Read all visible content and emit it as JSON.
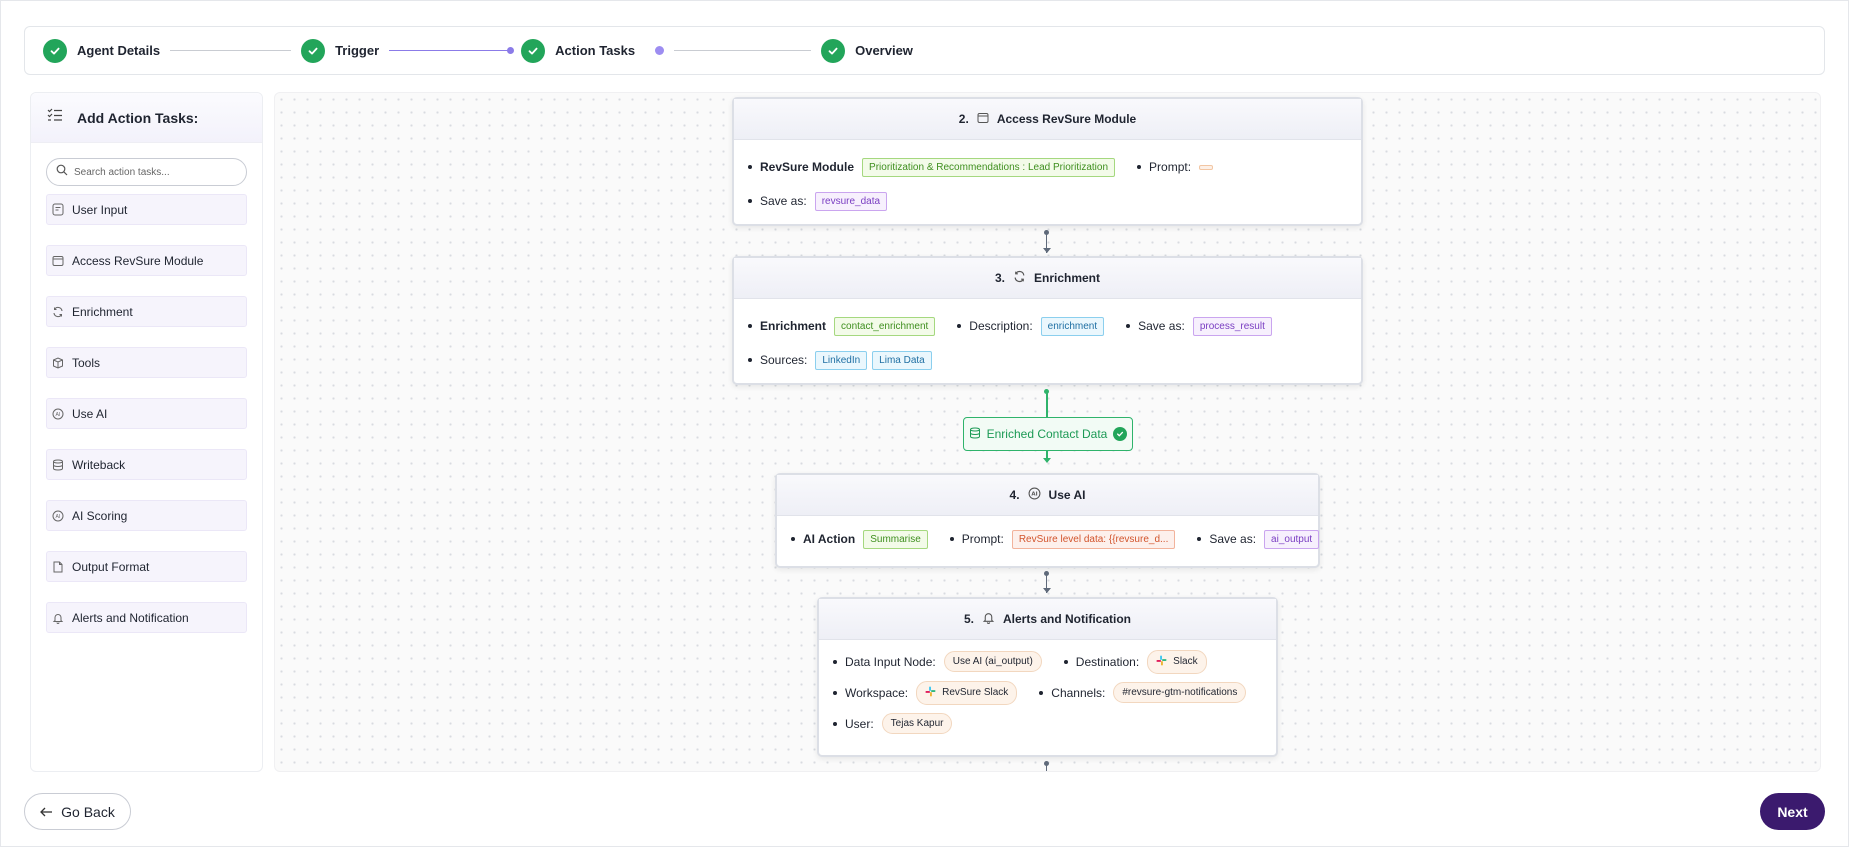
{
  "stepper": {
    "steps": [
      {
        "label": "Agent Details"
      },
      {
        "label": "Trigger"
      },
      {
        "label": "Action Tasks"
      },
      {
        "label": "Overview"
      }
    ]
  },
  "sidebar": {
    "title": "Add Action Tasks:",
    "search_placeholder": "Search action tasks...",
    "items": [
      {
        "label": "User Input",
        "icon": "user-input-icon"
      },
      {
        "label": "Access RevSure Module",
        "icon": "module-icon"
      },
      {
        "label": "Enrichment",
        "icon": "refresh-icon"
      },
      {
        "label": "Tools",
        "icon": "tools-icon"
      },
      {
        "label": "Use AI",
        "icon": "ai-icon"
      },
      {
        "label": "Writeback",
        "icon": "database-icon"
      },
      {
        "label": "AI Scoring",
        "icon": "ai-scoring-icon"
      },
      {
        "label": "Output Format",
        "icon": "document-icon"
      },
      {
        "label": "Alerts and Notification",
        "icon": "bell-icon"
      }
    ]
  },
  "nodes": {
    "n2": {
      "number": "2.",
      "title": "Access RevSure Module",
      "module_label": "RevSure Module",
      "module_value": "Prioritization & Recommendations : Lead Prioritization",
      "prompt_label": "Prompt:",
      "save_label": "Save as:",
      "save_value": "revsure_data"
    },
    "n3": {
      "number": "3.",
      "title": "Enrichment",
      "enrichment_label": "Enrichment",
      "enrichment_value": "contact_enrichment",
      "description_label": "Description:",
      "description_value": "enrichment",
      "save_label": "Save as:",
      "save_value": "process_result",
      "sources_label": "Sources:",
      "sources": [
        "LinkedIn",
        "Lima Data"
      ]
    },
    "data_output": {
      "label": "Enriched Contact Data"
    },
    "n4": {
      "number": "4.",
      "title": "Use AI",
      "action_label": "AI Action",
      "action_value": "Summarise",
      "prompt_label": "Prompt:",
      "prompt_value": "RevSure level data: {{revsure_d...",
      "save_label": "Save as:",
      "save_value": "ai_output"
    },
    "n5": {
      "number": "5.",
      "title": "Alerts and Notification",
      "input_label": "Data Input Node:",
      "input_value": "Use AI (ai_output)",
      "destination_label": "Destination:",
      "destination_value": "Slack",
      "workspace_label": "Workspace:",
      "workspace_value": "RevSure Slack",
      "channels_label": "Channels:",
      "channels_value": "#revsure-gtm-notifications",
      "user_label": "User:",
      "user_value": "Tejas Kapur"
    }
  },
  "footer": {
    "back_label": "Go Back",
    "next_label": "Next"
  },
  "colors": {
    "accent_purple": "#3b1a6e",
    "success_green": "#22a55a",
    "stepper_active": "#8b7be8"
  }
}
